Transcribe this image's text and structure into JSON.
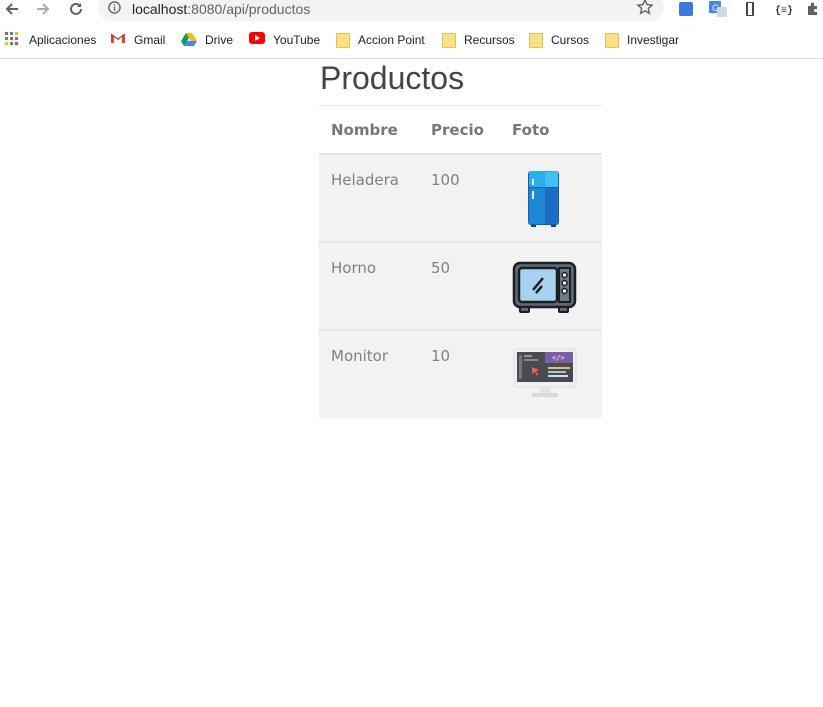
{
  "browser": {
    "url_host": "localhost",
    "url_path": ":8080/api/productos",
    "bookmarks": [
      {
        "label": "Aplicaciones",
        "icon": "apps-grid-icon"
      },
      {
        "label": "Gmail",
        "icon": "gmail-icon"
      },
      {
        "label": "Drive",
        "icon": "drive-icon"
      },
      {
        "label": "YouTube",
        "icon": "youtube-icon"
      },
      {
        "label": "Accion Point",
        "icon": "folder-icon"
      },
      {
        "label": "Recursos",
        "icon": "folder-icon"
      },
      {
        "label": "Cursos",
        "icon": "folder-icon"
      },
      {
        "label": "Investigar",
        "icon": "folder-icon"
      }
    ]
  },
  "page": {
    "title": "Productos",
    "headers": {
      "nombre": "Nombre",
      "precio": "Precio",
      "foto": "Foto"
    },
    "rows": [
      {
        "nombre": "Heladera",
        "precio": "100",
        "icon": "fridge-icon"
      },
      {
        "nombre": "Horno",
        "precio": "50",
        "icon": "oven-icon"
      },
      {
        "nombre": "Monitor",
        "precio": "10",
        "icon": "monitor-icon"
      }
    ]
  }
}
